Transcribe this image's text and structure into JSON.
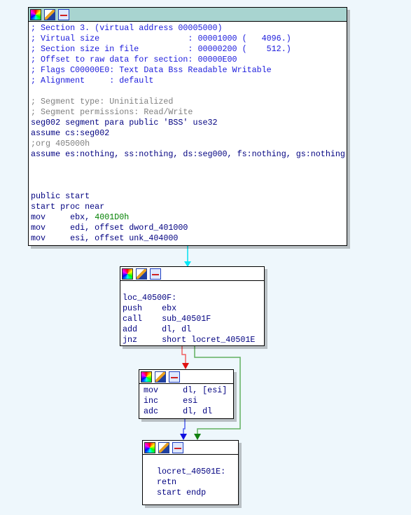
{
  "colors": {
    "background": "#eef7fc",
    "comment": "#1a1adc",
    "gray": "#808080",
    "code": "#000080",
    "number": "#008000",
    "edge_flow": "#00e0f0",
    "edge_false": "#e02020",
    "edge_true": "#20a020",
    "edge_normal": "#2020e0"
  },
  "header_icons": [
    "color-palette-icon",
    "edit-pencil-icon",
    "graph-overview-icon"
  ],
  "nodes": [
    {
      "lines": [
        [
          {
            "t": "; Section 3. (virtual address 00005000)",
            "c": "comment"
          }
        ],
        [
          {
            "t": "; Virtual size                  : 00001000 (   4096.)",
            "c": "comment"
          }
        ],
        [
          {
            "t": "; Section size in file          : 00000200 (    512.)",
            "c": "comment"
          }
        ],
        [
          {
            "t": "; Offset to raw data for section: 00000E00",
            "c": "comment"
          }
        ],
        [
          {
            "t": "; Flags C00000E0: Text Data Bss Readable Writable",
            "c": "comment"
          }
        ],
        [
          {
            "t": "; Alignment     : default",
            "c": "comment"
          }
        ],
        [],
        [
          {
            "t": "; Segment type: Uninitialized",
            "c": "gray"
          }
        ],
        [
          {
            "t": "; Segment permissions: Read/Write",
            "c": "gray"
          }
        ],
        [
          {
            "t": "seg002 segment para public 'BSS' use32",
            "c": "code"
          }
        ],
        [
          {
            "t": "assume cs:seg002",
            "c": "code"
          }
        ],
        [
          {
            "t": ";org 405000h",
            "c": "gray"
          }
        ],
        [
          {
            "t": "assume es:nothing, ss:nothing, ds:seg000, fs:nothing, gs:nothing",
            "c": "code"
          }
        ],
        [],
        [],
        [],
        [
          {
            "t": "public start",
            "c": "code"
          }
        ],
        [
          {
            "t": "start proc near",
            "c": "code"
          }
        ],
        [
          {
            "t": "mov     ebx, ",
            "c": "code"
          },
          {
            "t": "4001D0h",
            "c": "num"
          }
        ],
        [
          {
            "t": "mov     edi, offset dword_401000",
            "c": "code"
          }
        ],
        [
          {
            "t": "mov     esi, offset unk_404000",
            "c": "code"
          }
        ]
      ]
    },
    {
      "lines": [
        [],
        [
          {
            "t": "loc_40500F:",
            "c": "code"
          }
        ],
        [
          {
            "t": "push    ebx",
            "c": "code"
          }
        ],
        [
          {
            "t": "call    sub_40501F",
            "c": "code"
          }
        ],
        [
          {
            "t": "add     dl, dl",
            "c": "code"
          }
        ],
        [
          {
            "t": "jnz     short locret_40501E",
            "c": "code"
          }
        ]
      ]
    },
    {
      "lines": [
        [
          {
            "t": "mov     dl, [esi]",
            "c": "code"
          }
        ],
        [
          {
            "t": "inc     esi",
            "c": "code"
          }
        ],
        [
          {
            "t": "adc     dl, dl",
            "c": "code"
          }
        ]
      ]
    },
    {
      "lines": [
        [],
        [
          {
            "t": "locret_40501E:",
            "c": "code"
          }
        ],
        [
          {
            "t": "retn",
            "c": "code"
          }
        ],
        [
          {
            "t": "start endp",
            "c": "code"
          }
        ]
      ]
    }
  ]
}
